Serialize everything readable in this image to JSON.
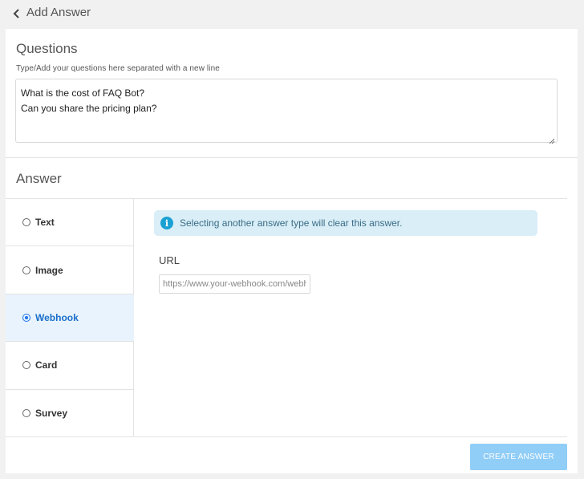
{
  "header": {
    "back_icon": "chevron-left-icon",
    "title": "Add Answer"
  },
  "questions": {
    "title": "Questions",
    "hint": "Type/Add your questions here separated with a new line",
    "value": "What is the cost of FAQ Bot?\nCan you share the pricing plan?"
  },
  "answer": {
    "title": "Answer",
    "types": [
      {
        "label": "Text",
        "selected": false
      },
      {
        "label": "Image",
        "selected": false
      },
      {
        "label": "Webhook",
        "selected": true
      },
      {
        "label": "Card",
        "selected": false
      },
      {
        "label": "Survey",
        "selected": false
      }
    ],
    "info_icon": "info-icon",
    "info_glyph": "i",
    "info_message": "Selecting another answer type will clear this answer.",
    "url_label": "URL",
    "url_placeholder": "https://www.your-webhook.com/webhook",
    "url_value": ""
  },
  "footer": {
    "create_label": "CREATE ANSWER"
  },
  "colors": {
    "accent": "#1a73e8",
    "button_disabled": "#90cdf7",
    "info_bg": "#d9eef7",
    "selected_bg": "#e8f3fd"
  }
}
